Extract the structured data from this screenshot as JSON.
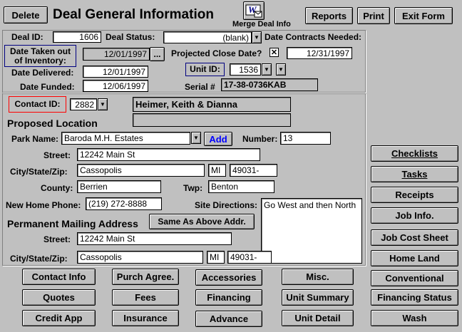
{
  "header": {
    "delete_label": "Delete",
    "title": "Deal General Information",
    "merge_label": "Merge Deal Info",
    "reports_label": "Reports",
    "print_label": "Print",
    "exit_label": "Exit Form"
  },
  "deal": {
    "deal_id_label": "Deal ID:",
    "deal_id": "1606",
    "deal_status_label": "Deal Status:",
    "deal_status": "(blank)",
    "date_contracts_label": "Date Contracts Needed:",
    "date_taken_label": "Date Taken out of Inventory:",
    "date_taken": "12/01/1997",
    "ellipsis": "...",
    "projected_close_label": "Projected Close Date?",
    "projected_close_check": "✕",
    "projected_close": "12/31/1997",
    "date_delivered_label": "Date Delivered:",
    "date_delivered": "12/01/1997",
    "unit_id_label": "Unit ID:",
    "unit_id": "1536",
    "date_funded_label": "Date Funded:",
    "date_funded": "12/06/1997",
    "serial_label": "Serial #",
    "serial": "17-38-0736KAB"
  },
  "contact": {
    "contact_id_label": "Contact ID:",
    "contact_id": "2882",
    "name": "Heimer, Keith & Dianna",
    "name2": ""
  },
  "location": {
    "section_title": "Proposed Location",
    "park_name_label": "Park Name:",
    "park_name": "Baroda M.H. Estates",
    "add_label": "Add",
    "number_label": "Number:",
    "number": "13",
    "street_label": "Street:",
    "street": "12242 Main St",
    "city_label": "City/State/Zip:",
    "city": "Cassopolis",
    "state": "MI",
    "zip": "49031-",
    "county_label": "County:",
    "county": "Berrien",
    "twp_label": "Twp:",
    "twp": "Benton",
    "phone_label": "New Home Phone:",
    "phone": "(219) 272-8888",
    "site_directions_label": "Site Directions:",
    "site_directions": "Go West and then North"
  },
  "mailing": {
    "section_title": "Permanent Mailing Address",
    "same_label": "Same As Above Addr.",
    "street_label": "Street:",
    "street": "12242 Main St",
    "city_label": "City/State/Zip:",
    "city": "Cassopolis",
    "state": "MI",
    "zip": "49031-"
  },
  "side_buttons": [
    "Checklists",
    "Tasks",
    "Receipts",
    "Job Info.",
    "Job Cost Sheet",
    "Home Land",
    "Conventional",
    "Financing Status",
    "Wash"
  ],
  "bottom_buttons": {
    "contact_info": "Contact Info",
    "purch_agree": "Purch Agree.",
    "accessories": "Accessories",
    "misc": "Misc.",
    "quotes": "Quotes",
    "fees": "Fees",
    "financing": "Financing",
    "unit_summary": "Unit Summary",
    "credit_app": "Credit App",
    "insurance": "Insurance",
    "advance": "Advance",
    "unit_detail": "Unit Detail"
  },
  "colors": {
    "highlight_blue": "#000080",
    "highlight_red": "#ff0000",
    "add_blue": "#0000ff"
  }
}
